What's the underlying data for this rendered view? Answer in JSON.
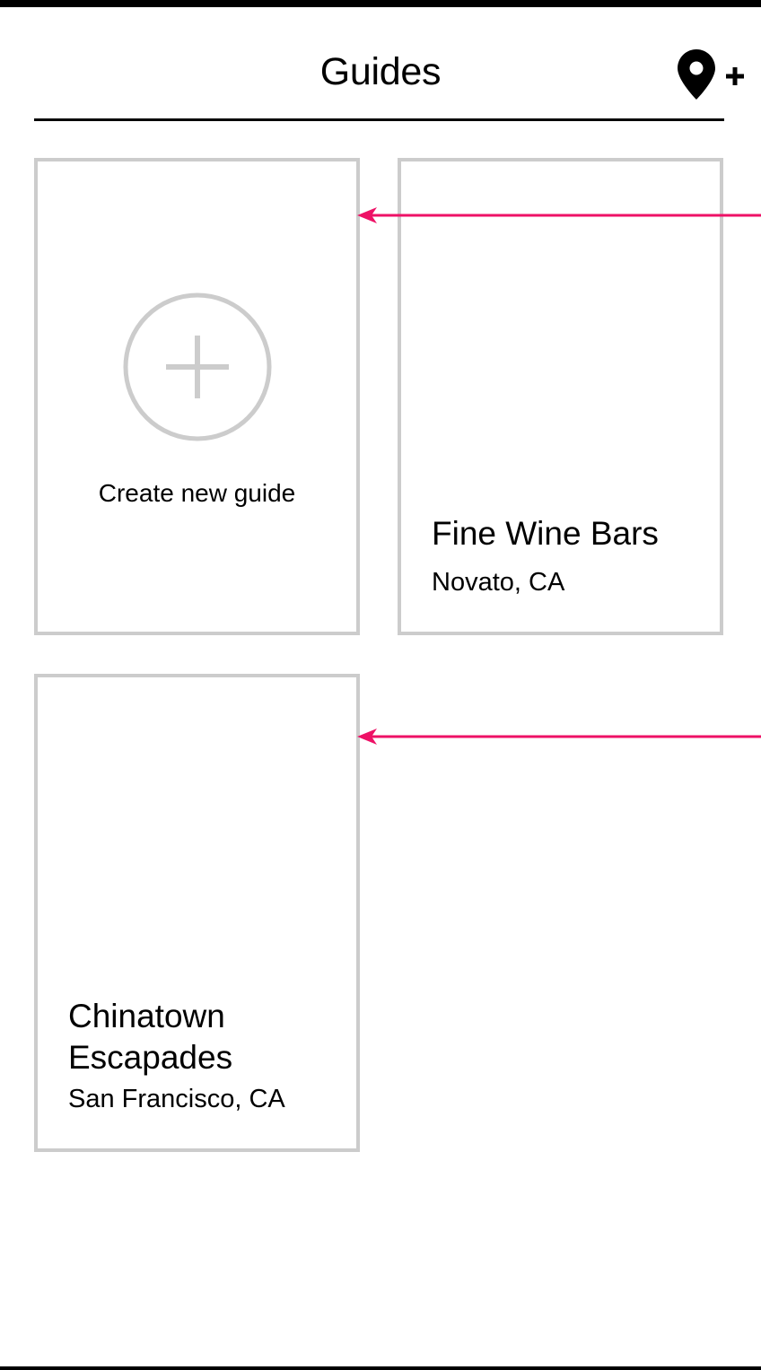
{
  "header": {
    "title": "Guides",
    "add_location_icon": "map-pin-plus-icon"
  },
  "create_card": {
    "label": "Create new guide",
    "icon": "plus-circle-icon"
  },
  "guides": [
    {
      "title": "Fine Wine Bars",
      "location": "Novato, CA"
    },
    {
      "title": "Chinatown Escapades",
      "location": "San Francisco, CA"
    }
  ],
  "colors": {
    "text": "#000000",
    "card_border": "#cccccc",
    "icon_gray": "#cccccc",
    "annotation": "#ee1166",
    "background": "#ffffff"
  }
}
